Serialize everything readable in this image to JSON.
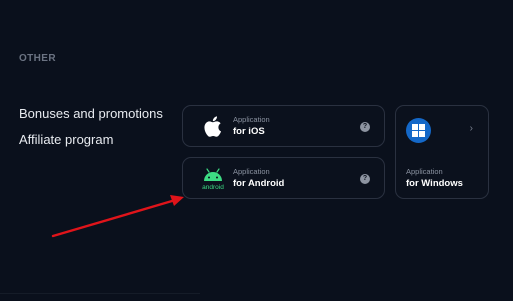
{
  "section": {
    "title": "OTHER"
  },
  "links": [
    {
      "label": "Bonuses and promotions"
    },
    {
      "label": "Affiliate program"
    }
  ],
  "apps": {
    "ios": {
      "sub": "Application",
      "main": "for iOS",
      "icon": "apple-icon"
    },
    "android": {
      "sub": "Application",
      "main": "for Android",
      "icon": "android-icon",
      "icon_text": "android"
    },
    "windows": {
      "sub": "Application",
      "main": "for Windows",
      "icon": "windows-icon"
    }
  },
  "info_glyph": "?",
  "chevron_glyph": "›",
  "colors": {
    "background": "#0a101c",
    "android_green": "#3ddc84",
    "windows_blue": "#1468c8",
    "annotation_arrow": "#e0141a"
  }
}
